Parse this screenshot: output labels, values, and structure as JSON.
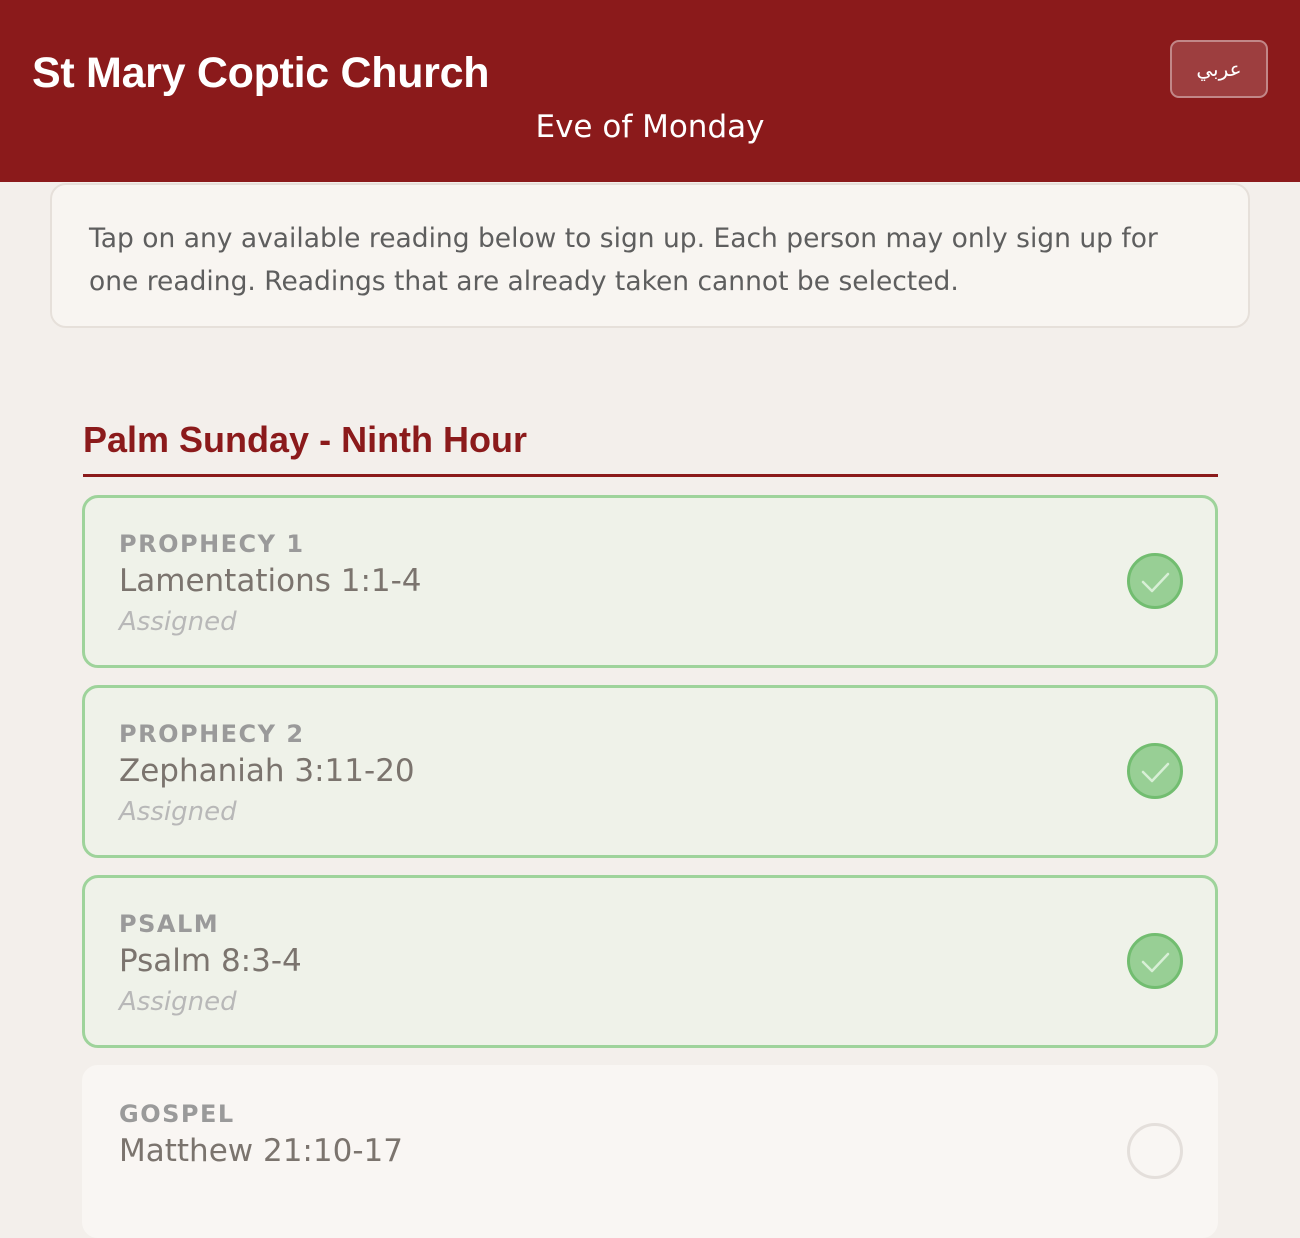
{
  "header": {
    "church_name": "St Mary Coptic Church",
    "subtitle": "Eve of Monday",
    "language_button": "عربي"
  },
  "instructions": "Tap on any available reading below to sign up. Each person may only sign up for one reading. Readings that are already taken cannot be selected.",
  "section": {
    "title": "Palm Sunday - Ninth Hour",
    "readings": [
      {
        "label": "PROPHECY 1",
        "reference": "Lamentations 1:1-4",
        "status": "Assigned",
        "state": "assigned",
        "icon": "check-circle-icon"
      },
      {
        "label": "PROPHECY 2",
        "reference": "Zephaniah 3:11-20",
        "status": "Assigned",
        "state": "assigned",
        "icon": "check-circle-icon"
      },
      {
        "label": "PSALM",
        "reference": "Psalm 8:3-4",
        "status": "Assigned",
        "state": "assigned",
        "icon": "check-circle-icon"
      },
      {
        "label": "GOSPEL",
        "reference": "Matthew 21:10-17",
        "state": "available",
        "icon": "empty-circle-icon"
      }
    ]
  },
  "colors": {
    "header_bg": "#8b1a1b",
    "accent": "#8b1a1b",
    "assigned_border": "#9ed39b",
    "assigned_bg": "#eff2e9",
    "check_fill": "#98cf95",
    "page_bg": "#f3efeb"
  }
}
